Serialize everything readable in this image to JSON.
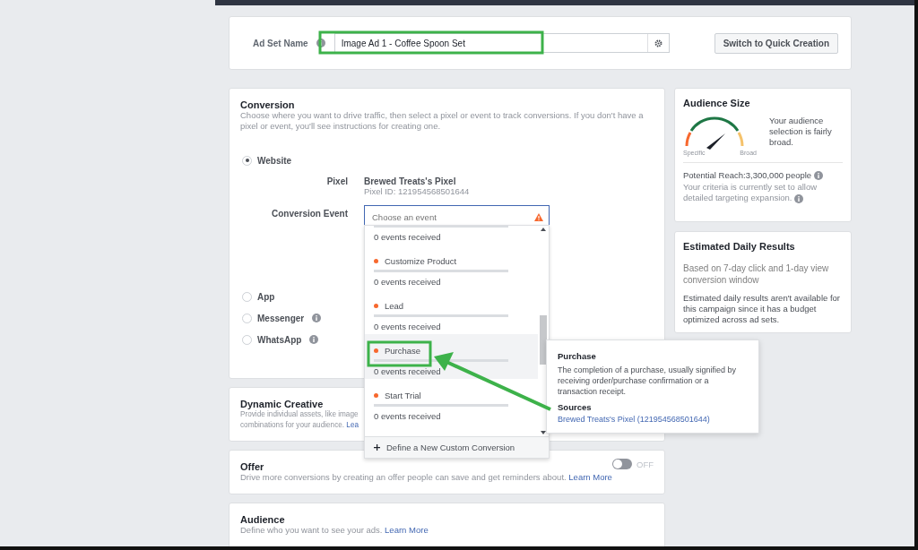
{
  "ad_set_name": {
    "label": "Ad Set Name",
    "value": "Image Ad 1 - Coffee Spoon Set",
    "switch_button": "Switch to Quick Creation"
  },
  "conversion": {
    "title": "Conversion",
    "description": "Choose where you want to drive traffic, then select a pixel or event to track conversions. If you don't have a pixel or event, you'll see instructions for creating one.",
    "destinations": [
      {
        "label": "Website",
        "selected": true,
        "info": false
      },
      {
        "label": "App",
        "selected": false,
        "info": false
      },
      {
        "label": "Messenger",
        "selected": false,
        "info": true
      },
      {
        "label": "WhatsApp",
        "selected": false,
        "info": true
      }
    ],
    "pixel_label": "Pixel",
    "pixel_name": "Brewed Treats's Pixel",
    "pixel_id": "Pixel ID: 121954568501644",
    "event_label": "Conversion Event",
    "event_placeholder": "Choose an event"
  },
  "event_dropdown": {
    "items": [
      {
        "status": "0 events received",
        "highlighted": false
      },
      {
        "name": "Customize Product",
        "status": "0 events received",
        "color": "#f7682e",
        "highlighted": false
      },
      {
        "name": "Lead",
        "status": "0 events received",
        "color": "#f7682e",
        "highlighted": false
      },
      {
        "name": "Purchase",
        "status": "0 events received",
        "color": "#f7682e",
        "highlighted": true
      },
      {
        "name": "Start Trial",
        "status": "0 events received",
        "color": "#f7682e",
        "highlighted": false
      }
    ],
    "footer": "Define a New Custom Conversion"
  },
  "tooltip": {
    "title": "Purchase",
    "description": "The completion of a purchase, usually signified by receiving order/purchase confirmation or a transaction receipt.",
    "sources_label": "Sources",
    "source": "Brewed Treats's Pixel (121954568501644)"
  },
  "dynamic_creative": {
    "title": "Dynamic Creative",
    "description": "Provide individual assets, like image",
    "description_2": "combinations for your audience.",
    "link": "Lea"
  },
  "offer": {
    "title": "Offer",
    "description": "Drive more conversions by creating an offer people can save and get reminders about.",
    "link": "Learn More",
    "toggle": {
      "on": false,
      "label": "OFF"
    }
  },
  "audience": {
    "title": "Audience",
    "description": "Define who you want to see your ads.",
    "link": "Learn More"
  },
  "audience_size": {
    "title": "Audience Size",
    "summary": "Your audience selection is fairly broad.",
    "gauge_left": "Specific",
    "gauge_right": "Broad",
    "reach": "Potential Reach:3,300,000 people",
    "criteria": "Your criteria is currently set to allow detailed targeting expansion."
  },
  "daily_results": {
    "title": "Estimated Daily Results",
    "basis": "Based on 7-day click and 1-day view conversion window",
    "note": "Estimated daily results aren't available for this campaign since it has a budget optimized across ad sets."
  }
}
